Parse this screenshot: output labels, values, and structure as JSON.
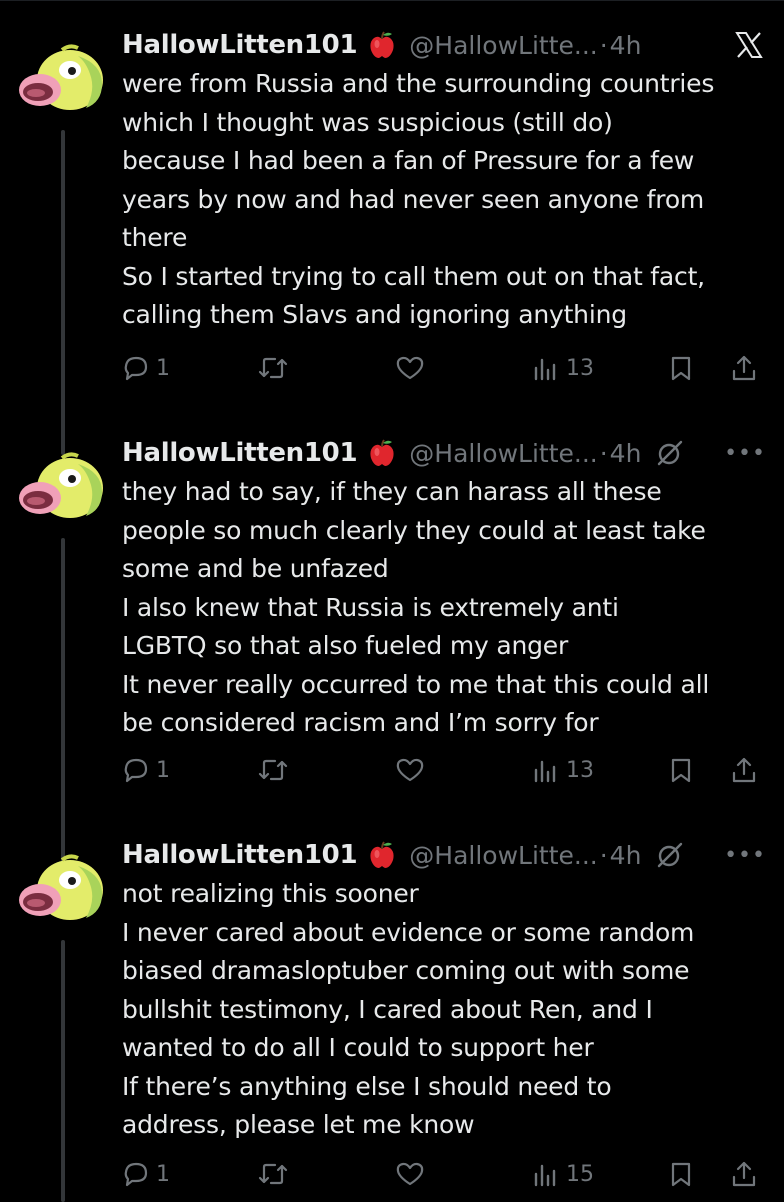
{
  "platform_logo": "x-logo",
  "colors": {
    "background": "#000000",
    "text": "#e7e9ea",
    "secondary": "#71767b",
    "thread_line": "#333639"
  },
  "tweets": [
    {
      "author": {
        "display_name": "HallowLitten101",
        "emoji": "red-apple",
        "handle": "@HallowLitte...",
        "separator": "·",
        "time": "4h"
      },
      "body_lines": [
        "were from Russia and the surrounding countries",
        "which I thought was suspicious (still do)",
        "because I had been a fan of Pressure for a few",
        "years by now and had never seen anyone from",
        "there",
        "So I started trying to call them out on that fact,",
        "calling them Slavs and ignoring anything"
      ],
      "stats": {
        "replies": "1",
        "views": "13"
      }
    },
    {
      "author": {
        "display_name": "HallowLitten101",
        "emoji": "red-apple",
        "handle": "@HallowLitte...",
        "separator": "·",
        "time": "4h"
      },
      "body_lines": [
        "they had to say, if they can harass all these",
        "people so much clearly they could at least take",
        "some and be unfazed",
        "I also knew that Russia is extremely anti",
        "LGBTQ so that also fueled my anger",
        "It never really occurred to me that this could all",
        "be considered racism and I’m sorry for"
      ],
      "stats": {
        "replies": "1",
        "views": "13"
      }
    },
    {
      "author": {
        "display_name": "HallowLitten101",
        "emoji": "red-apple",
        "handle": "@HallowLitte...",
        "separator": "·",
        "time": "4h"
      },
      "body_lines": [
        "not realizing this sooner",
        "I never cared about evidence or some random",
        "biased dramasloptuber coming out with some",
        "bullshit testimony, I cared about Ren, and I",
        "wanted to do all I could to support her",
        "If there’s anything else I should need to",
        "address, please let me know"
      ],
      "stats": {
        "replies": "1",
        "views": "15"
      }
    }
  ]
}
